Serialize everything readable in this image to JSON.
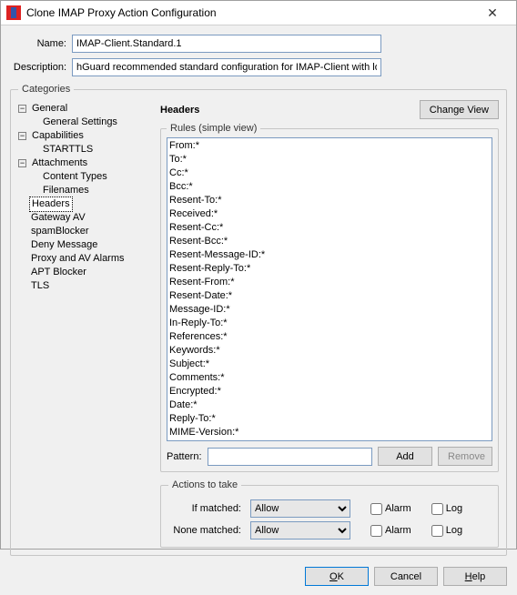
{
  "window": {
    "title": "Clone IMAP Proxy Action Configuration",
    "close_glyph": "✕"
  },
  "form": {
    "name_label": "Name:",
    "name_value": "IMAP-Client.Standard.1",
    "desc_label": "Description:",
    "desc_value": "hGuard recommended standard configuration for IMAP-Client with logging enabled"
  },
  "categories": {
    "legend": "Categories",
    "tree": {
      "general": {
        "label": "General",
        "glyph": "−"
      },
      "general_settings": {
        "label": "General Settings"
      },
      "capabilities": {
        "label": "Capabilities",
        "glyph": "−"
      },
      "starttls": {
        "label": "STARTTLS"
      },
      "attachments": {
        "label": "Attachments",
        "glyph": "−"
      },
      "content_types": {
        "label": "Content Types"
      },
      "filenames": {
        "label": "Filenames"
      },
      "headers": {
        "label": "Headers"
      },
      "gateway_av": {
        "label": "Gateway AV"
      },
      "spamblocker": {
        "label": "spamBlocker"
      },
      "deny_message": {
        "label": "Deny Message"
      },
      "proxy_av": {
        "label": "Proxy and AV Alarms"
      },
      "apt_blocker": {
        "label": "APT Blocker"
      },
      "tls": {
        "label": "TLS"
      }
    }
  },
  "headers": {
    "title": "Headers",
    "change_view": "Change View",
    "rules_legend": "Rules (simple view)",
    "rules": [
      "From:*",
      "To:*",
      "Cc:*",
      "Bcc:*",
      "Resent-To:*",
      "Received:*",
      "Resent-Cc:*",
      "Resent-Bcc:*",
      "Resent-Message-ID:*",
      "Resent-Reply-To:*",
      "Resent-From:*",
      "Resent-Date:*",
      "Message-ID:*",
      "In-Reply-To:*",
      "References:*",
      "Keywords:*",
      "Subject:*",
      "Comments:*",
      "Encrypted:*",
      "Date:*",
      "Reply-To:*",
      "MIME-Version:*"
    ],
    "pattern_label": "Pattern:",
    "add_label": "Add",
    "remove_label": "Remove"
  },
  "actions": {
    "legend": "Actions to take",
    "if_matched_label": "If matched:",
    "none_matched_label": "None matched:",
    "if_matched_value": "Allow",
    "none_matched_value": "Allow",
    "alarm_label": "Alarm",
    "log_label": "Log"
  },
  "footer": {
    "ok": "OK",
    "cancel": "Cancel",
    "help": "Help"
  }
}
